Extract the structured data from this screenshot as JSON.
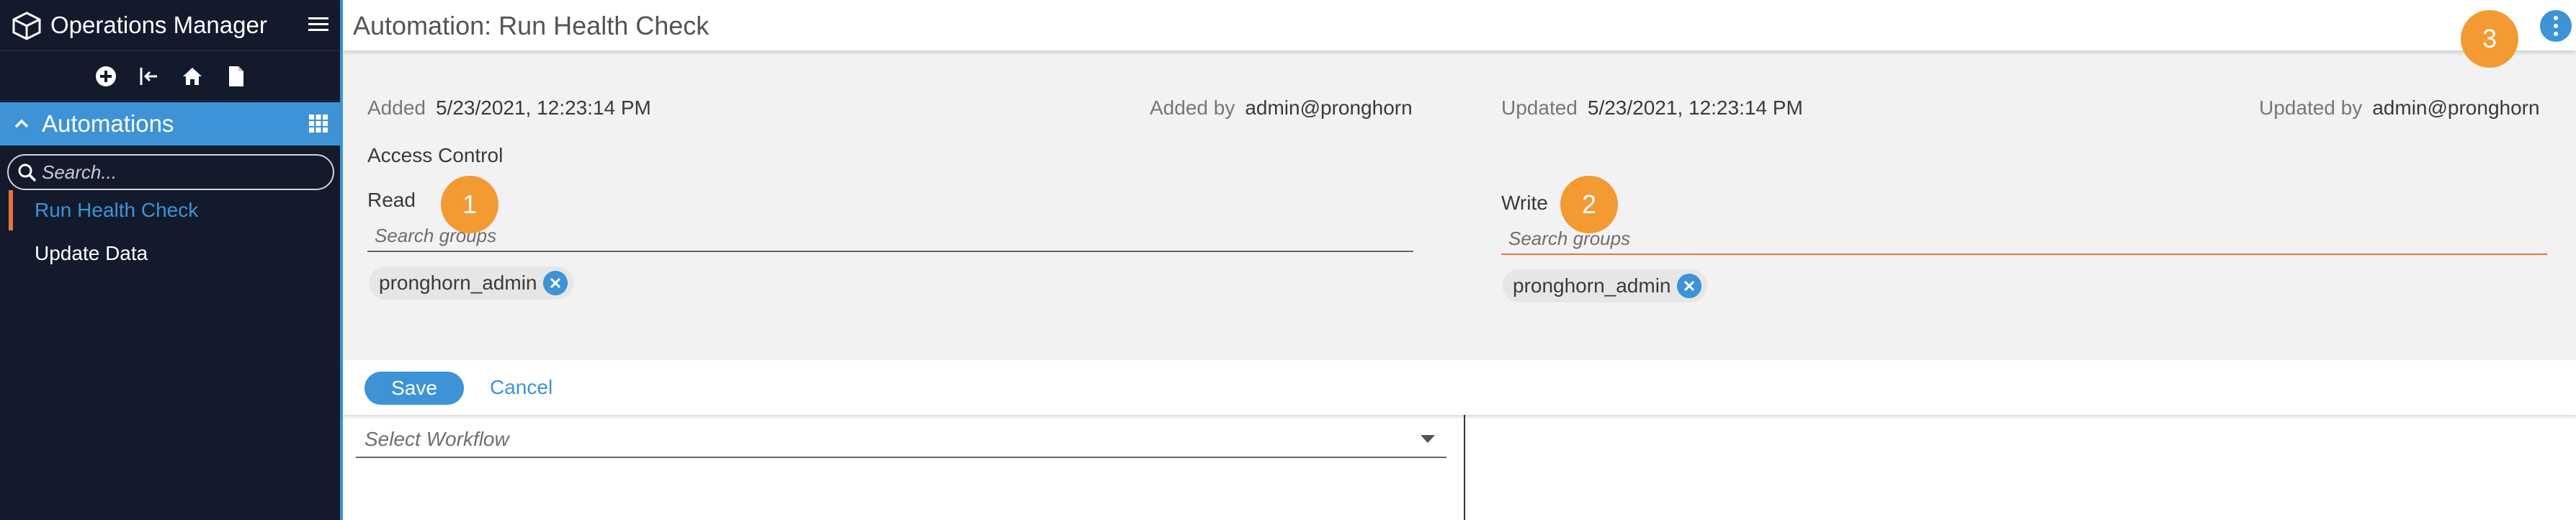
{
  "app": {
    "title": "Operations Manager"
  },
  "sidebar": {
    "toolbar_icons": [
      "add-circle-icon",
      "sign-in-icon",
      "home-icon",
      "document-icon"
    ],
    "section": {
      "label": "Automations"
    },
    "search": {
      "placeholder": "Search...",
      "value": ""
    },
    "items": [
      {
        "label": "Run Health Check",
        "active": true
      },
      {
        "label": "Update Data",
        "active": false
      }
    ]
  },
  "page": {
    "title": "Automation: Run Health Check"
  },
  "meta": {
    "added_label": "Added",
    "added_value": "5/23/2021, 12:23:14 PM",
    "added_by_label": "Added by",
    "added_by_value": "admin@pronghorn",
    "updated_label": "Updated",
    "updated_value": "5/23/2021, 12:23:14 PM",
    "updated_by_label": "Updated by",
    "updated_by_value": "admin@pronghorn"
  },
  "access": {
    "title": "Access Control",
    "read": {
      "label": "Read",
      "placeholder": "Search groups",
      "chips": [
        "pronghorn_admin"
      ]
    },
    "write": {
      "label": "Write",
      "placeholder": "Search groups",
      "chips": [
        "pronghorn_admin"
      ]
    }
  },
  "badges": [
    "1",
    "2",
    "3"
  ],
  "actions": {
    "save_label": "Save",
    "cancel_label": "Cancel"
  },
  "workflow": {
    "placeholder": "Select Workflow"
  },
  "colors": {
    "sidebar_bg": "#121a2c",
    "accent": "#3d93d6",
    "active_marker": "#e5723d",
    "badge": "#f39a33"
  }
}
